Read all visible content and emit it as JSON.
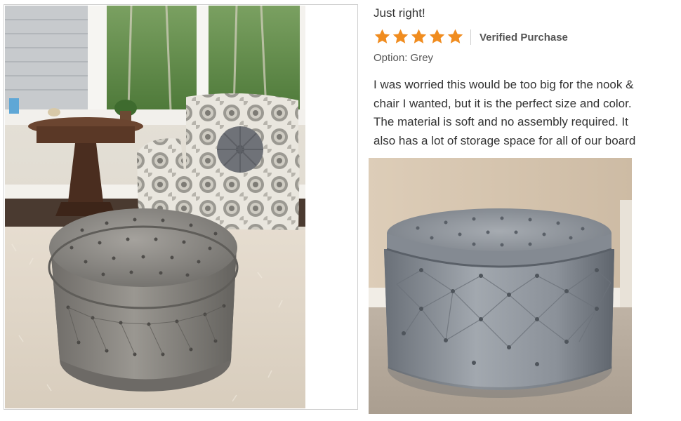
{
  "review": {
    "title": "Just right!",
    "rating": 5,
    "rating_max": 5,
    "star_color": "#f08c1f",
    "verified_label": "Verified Purchase",
    "option_label": "Option: Grey",
    "body_lines": [
      "I was worried this would be too big for the nook &",
      "chair I wanted, but it is the perfect size and color.",
      "The material is soft and no assembly required. It",
      "also has a lot of storage space for all of our board"
    ]
  },
  "images": {
    "left": {
      "name": "customer-photo-living-room"
    },
    "right": {
      "name": "customer-photo-ottoman"
    }
  },
  "icons": {
    "star": "star-icon"
  }
}
